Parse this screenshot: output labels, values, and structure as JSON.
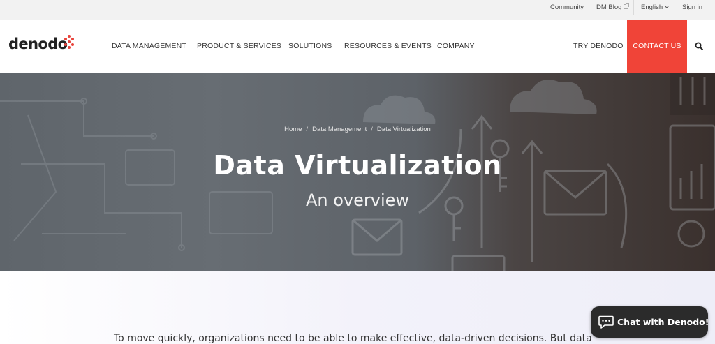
{
  "utility_bar": {
    "community": "Community",
    "dm_blog": "DM Blog",
    "language": "English",
    "sign_in": "Sign in"
  },
  "logo": {
    "text": "denodo"
  },
  "nav": {
    "items": [
      {
        "label": "DATA MANAGEMENT"
      },
      {
        "label": "PRODUCT & SERVICES"
      },
      {
        "label": "SOLUTIONS"
      },
      {
        "label": "RESOURCES & EVENTS"
      },
      {
        "label": "COMPANY"
      }
    ],
    "try_label": "TRY DENODO",
    "contact_label": "CONTACT US"
  },
  "breadcrumb": {
    "items": [
      "Home",
      "Data Management",
      "Data Virtualization"
    ],
    "separator": "/"
  },
  "hero": {
    "title": "Data Virtualization",
    "subtitle": "An overview"
  },
  "intro": {
    "text": "To move quickly, organizations need to be able to make effective, data-driven decisions. But data"
  },
  "chat": {
    "label": "Chat with Denodo!"
  },
  "colors": {
    "accent": "#f04438",
    "logo_dots": "#e8423a",
    "chat_bg": "#2b2b2b"
  }
}
